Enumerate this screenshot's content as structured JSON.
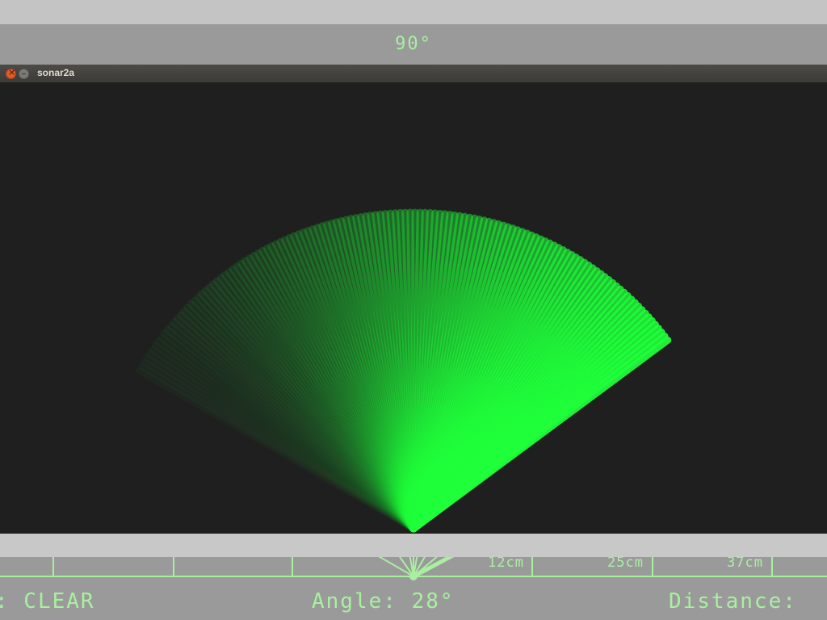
{
  "top_readout": {
    "angle": "90°"
  },
  "window": {
    "title": "sonar2a"
  },
  "sweep": {
    "beam_color": "#1fff3a",
    "background": "#1f1f1f"
  },
  "bottom_panel": {
    "status": ": CLEAR",
    "angle": "Angle: 28°",
    "distance": "Distance:",
    "range_labels": [
      "12cm",
      "25cm",
      "37cm"
    ]
  },
  "colors": {
    "hud_green": "#a8f0a0",
    "panel_gray": "#9a9a9a",
    "bar_gray": "#c8c8c8"
  }
}
